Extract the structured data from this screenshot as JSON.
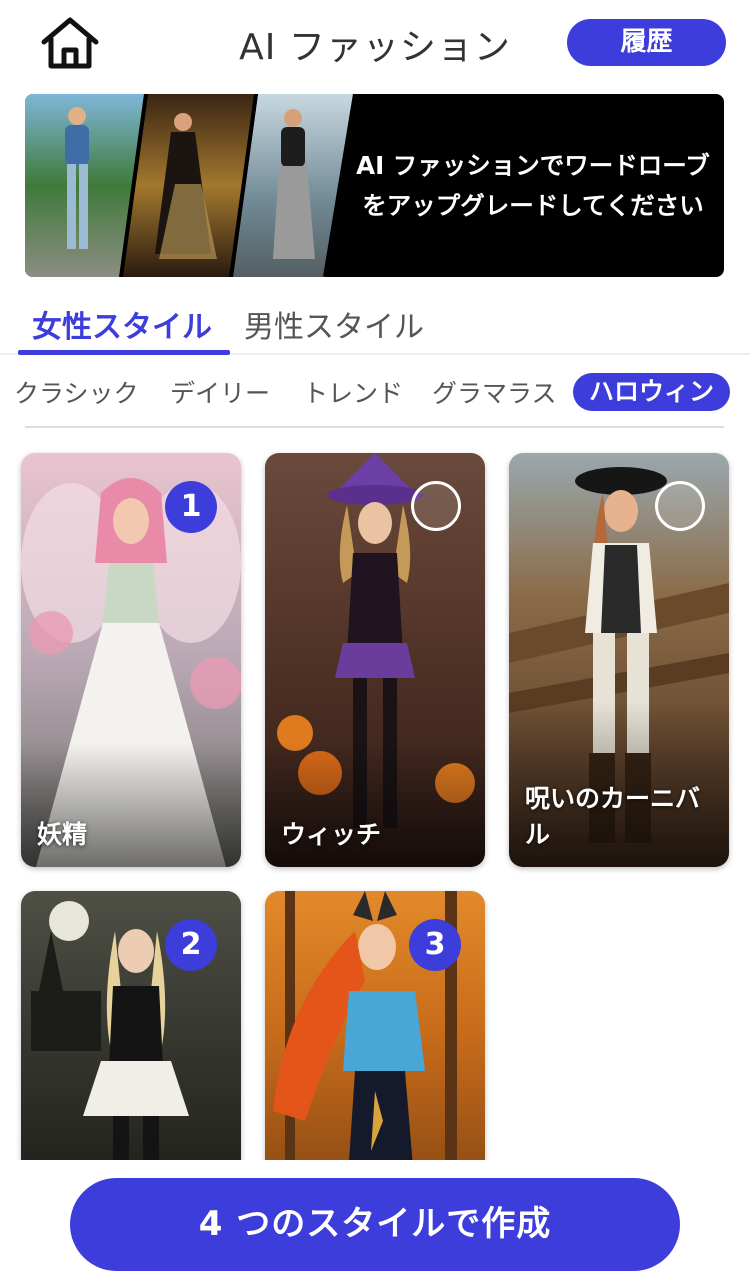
{
  "header": {
    "title": "AI ファッション",
    "history_label": "履歴"
  },
  "banner": {
    "line1": "AI ファッションでワードローブ",
    "line2": "をアップグレードしてください"
  },
  "tabs": [
    {
      "label": "女性スタイル",
      "active": true
    },
    {
      "label": "男性スタイル",
      "active": false
    }
  ],
  "categories": [
    {
      "label": "クラシック",
      "active": false
    },
    {
      "label": "デイリー",
      "active": false
    },
    {
      "label": "トレンド",
      "active": false
    },
    {
      "label": "グラマラス",
      "active": false
    },
    {
      "label": "ハロウィン",
      "active": true
    }
  ],
  "styles": [
    {
      "label": "妖精",
      "selected_order": "1"
    },
    {
      "label": "ウィッチ",
      "selected_order": null
    },
    {
      "label": "呪いのカーニバル",
      "selected_order": null
    },
    {
      "label": "",
      "selected_order": "2"
    },
    {
      "label": "",
      "selected_order": "3"
    }
  ],
  "cta": {
    "label": "4 つのスタイルで作成"
  },
  "colors": {
    "accent": "#3d3ddb",
    "background": "#ffffff"
  }
}
